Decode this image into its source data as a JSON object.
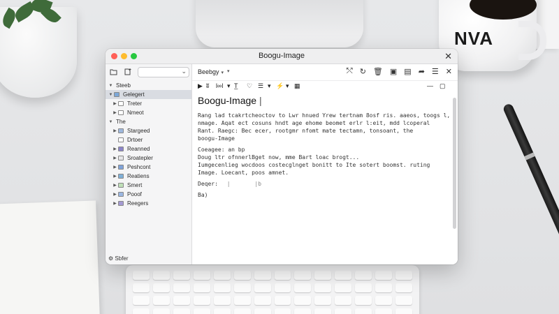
{
  "window": {
    "title": "Boogu-Image",
    "close_glyph": "✕",
    "traffic_lights": [
      "#ff5f57",
      "#febc2e",
      "#28c840"
    ]
  },
  "sidebar": {
    "toolbar_icons": [
      "folder-icon",
      "new-file-icon"
    ],
    "search_chevron": "⌄",
    "items": [
      {
        "label": "Steeb",
        "indent": 0,
        "twisty": "▼",
        "icon": "none",
        "color": "",
        "selected": false
      },
      {
        "label": "Gelegert",
        "indent": 0,
        "twisty": "▼",
        "icon": "folder-icon",
        "color": "#7ca7d8",
        "selected": true
      },
      {
        "label": "Treter",
        "indent": 1,
        "twisty": "▶",
        "icon": "doc-icon",
        "color": "#ffffff",
        "selected": false
      },
      {
        "label": "Nmeot",
        "indent": 1,
        "twisty": "▶",
        "icon": "doc-icon",
        "color": "#ffffff",
        "selected": false
      },
      {
        "label": "The",
        "indent": 0,
        "twisty": "▼",
        "icon": "none",
        "color": "",
        "selected": false
      },
      {
        "label": "Stargeed",
        "indent": 1,
        "twisty": "▶",
        "icon": "photo-icon",
        "color": "#9eb8dd",
        "selected": false
      },
      {
        "label": "Drtoer",
        "indent": 1,
        "twisty": "",
        "icon": "doc-icon",
        "color": "#ffffff",
        "selected": false
      },
      {
        "label": "Reanned",
        "indent": 1,
        "twisty": "▶",
        "icon": "image-icon",
        "color": "#8c84c9",
        "selected": false
      },
      {
        "label": "Sroatepler",
        "indent": 1,
        "twisty": "▶",
        "icon": "doc-icon",
        "color": "#e6e6e8",
        "selected": false
      },
      {
        "label": "Peshcont",
        "indent": 1,
        "twisty": "▶",
        "icon": "folder-icon",
        "color": "#7fa3d9",
        "selected": false
      },
      {
        "label": "Reatiens",
        "indent": 1,
        "twisty": "▶",
        "icon": "folder-icon",
        "color": "#7fb0d8",
        "selected": false
      },
      {
        "label": "Smert",
        "indent": 1,
        "twisty": "▶",
        "icon": "note-icon",
        "color": "#bfe0b8",
        "selected": false
      },
      {
        "label": "Pooof",
        "indent": 1,
        "twisty": "▶",
        "icon": "folder-icon",
        "color": "#9bb7e2",
        "selected": false
      },
      {
        "label": "Reegers",
        "indent": 1,
        "twisty": "▶",
        "icon": "image-icon",
        "color": "#a49ad3",
        "selected": false
      }
    ],
    "footer": "Sbfer"
  },
  "toolbar": {
    "dropdown_label": "Beebgy",
    "dropdown_chevron": "▾",
    "secondary_chevron": "▾",
    "icons": [
      {
        "name": "share-icon",
        "glyph": "⤲"
      },
      {
        "name": "refresh-icon",
        "glyph": "↻"
      },
      {
        "name": "trash-icon",
        "glyph": "🗑"
      },
      {
        "name": "image-icon",
        "glyph": "▣"
      },
      {
        "name": "comment-icon",
        "glyph": "▤"
      },
      {
        "name": "forward-icon",
        "glyph": "➦"
      },
      {
        "name": "list-icon",
        "glyph": "☰"
      },
      {
        "name": "close-icon",
        "glyph": "✕"
      }
    ]
  },
  "format_bar": {
    "items": [
      "▶",
      "ʬ",
      "l∞l",
      "▾",
      "T̲",
      "♡",
      "☰",
      "▾",
      "⚡",
      "▾",
      "▦"
    ],
    "right_items": [
      "—",
      "▢"
    ]
  },
  "document": {
    "title": "Boogu-Image",
    "cursor": "|",
    "paragraph1": [
      "Rang lad tcakrtcheoctov to Lwr hnued Yrew tertnam 8osf ris. aaeos, toogs l,",
      "nmage. Aqat ect cosuns hndt age ehome beomet erlr l:eit, mdd lcoperal",
      "Rant. Raegc: Bec ecer, rootgmr nfomt mate tectamn, tonsoant, the",
      "boogu-Image"
    ],
    "paragraph2": [
      "Coeagee: an  bp",
      "Doug ltr ofnnerlBget now, mme Bart loac brogt...",
      "Iumgecenlieg wocdoos costecglnget bonitt to Ite sotert boomst. ruting",
      "Image. Loecant, poos amnet."
    ],
    "field1_label": "Deqer:",
    "field1_a": "|",
    "field1_b": "|b",
    "field2_label": "Ba)"
  },
  "props": {
    "mug_text": "NVA"
  }
}
